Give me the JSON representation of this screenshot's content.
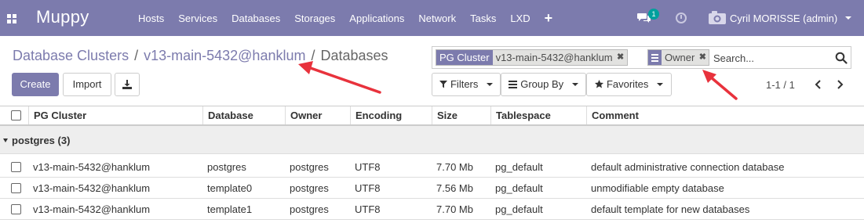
{
  "navbar": {
    "apps_icon": "grid-icon",
    "brand": "Muppy",
    "menu": [
      "Hosts",
      "Services",
      "Databases",
      "Storages",
      "Applications",
      "Network",
      "Tasks",
      "LXD",
      "+"
    ],
    "chat_icon": "comments-icon",
    "chat_badge": "1",
    "activity_icon": "clock-icon",
    "user_avatar_icon": "company-avatar-icon",
    "user_name": "Cyril MORISSE (admin)"
  },
  "breadcrumb": {
    "items": [
      "Database Clusters",
      "v13-main-5432@hanklum"
    ],
    "separator": "/",
    "current": "Databases"
  },
  "search": {
    "facets": [
      {
        "label": "PG Cluster",
        "value": "v13-main-5432@hanklum",
        "type": "filter"
      },
      {
        "label": "",
        "value": "Owner",
        "type": "groupby",
        "icon": "list-icon"
      }
    ],
    "placeholder": "Search...",
    "icon": "search-icon"
  },
  "buttons": {
    "create": "Create",
    "import": "Import",
    "download_icon": "download-icon",
    "filters": "Filters",
    "group_by": "Group By",
    "favorites": "Favorites"
  },
  "pager": {
    "value": "1-1 / 1"
  },
  "table": {
    "columns": [
      "PG Cluster",
      "Database",
      "Owner",
      "Encoding",
      "Size",
      "Tablespace",
      "Comment"
    ],
    "group": {
      "label": "postgres (3)"
    },
    "rows": [
      [
        "v13-main-5432@hanklum",
        "postgres",
        "postgres",
        "UTF8",
        "7.70 Mb",
        "pg_default",
        "default administrative connection database"
      ],
      [
        "v13-main-5432@hanklum",
        "template0",
        "postgres",
        "UTF8",
        "7.56 Mb",
        "pg_default",
        "unmodifiable empty database"
      ],
      [
        "v13-main-5432@hanklum",
        "template1",
        "postgres",
        "UTF8",
        "7.70 Mb",
        "pg_default",
        "default template for new databases"
      ]
    ]
  },
  "colors": {
    "brand": "#7c7bad",
    "annotation_arrow": "#e8323c",
    "badge": "#00a09d"
  }
}
